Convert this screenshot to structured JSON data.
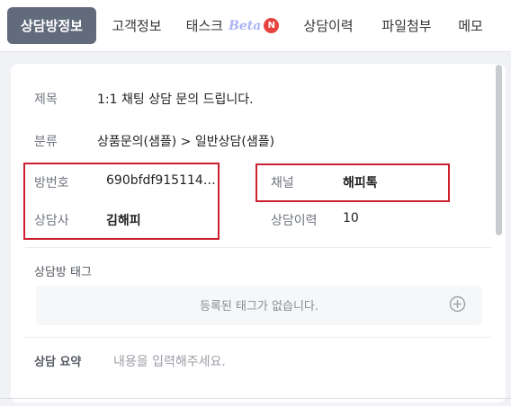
{
  "tabs": [
    {
      "label": "상담방정보",
      "active": true
    },
    {
      "label": "고객정보",
      "active": false
    },
    {
      "label": "태스크",
      "beta": "Beta",
      "badge": "N",
      "active": false
    },
    {
      "label": "상담이력",
      "active": false
    },
    {
      "label": "파일첨부",
      "active": false
    },
    {
      "label": "메모",
      "active": false
    }
  ],
  "info": {
    "title_label": "제목",
    "title_value": "1:1 채팅 상담 문의 드립니다.",
    "category_label": "분류",
    "category_value": "상품문의(샘플) > 일반상담(샘플)",
    "room_no_label": "방번호",
    "room_no_value": "690bfdf915114…",
    "channel_label": "채널",
    "channel_value": "해피톡",
    "agent_label": "상담사",
    "agent_value": "김해피",
    "history_label": "상담이력",
    "history_value": "10"
  },
  "tags": {
    "label": "상담방 태그",
    "empty_text": "등록된 태그가 없습니다."
  },
  "summary": {
    "label": "상담 요약",
    "placeholder": "내용을 입력해주세요."
  },
  "colors": {
    "active_tab": "#616b7c",
    "highlight": "#cc2030",
    "badge": "#e8423f",
    "beta": "#a9b4f5"
  }
}
